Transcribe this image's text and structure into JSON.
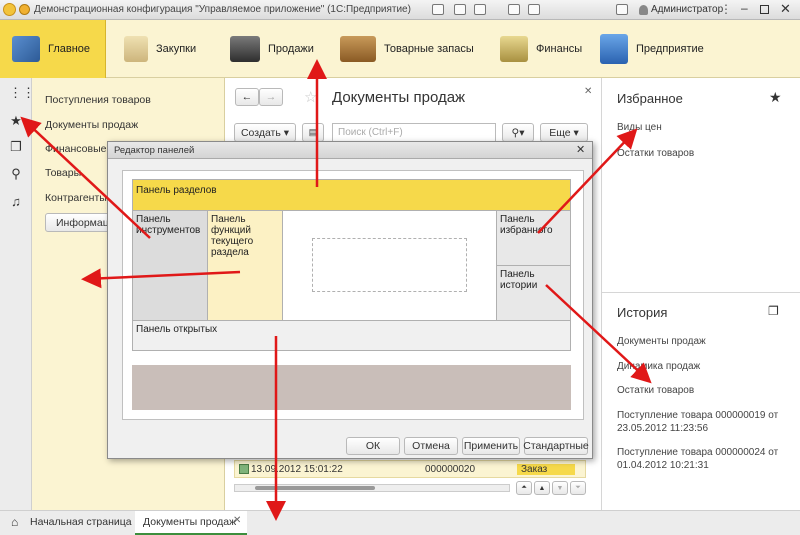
{
  "titlebar": {
    "title": "Демонстрационная конфигурация \"Управляемое приложение\" (1С:Предприятие)",
    "user": "Администратор"
  },
  "sections": [
    {
      "label": "Главное",
      "icon": "desk-lamp-icon"
    },
    {
      "label": "Закупки",
      "icon": "shopping-bag-icon"
    },
    {
      "label": "Продажи",
      "icon": "cash-register-icon"
    },
    {
      "label": "Товарные запасы",
      "icon": "box-icon"
    },
    {
      "label": "Финансы",
      "icon": "coins-icon"
    },
    {
      "label": "Предприятие",
      "icon": "building-icon"
    }
  ],
  "function_panel": {
    "items": [
      "Поступления товаров",
      "Документы продаж",
      "Финансовые д",
      "Товары",
      "Контрагенты"
    ],
    "info_button": "Информаци"
  },
  "workarea": {
    "title": "Документы продаж",
    "create_button": "Создать",
    "search_placeholder": "Поиск (Ctrl+F)",
    "more_button": "Еще",
    "row": {
      "date": "13.09.2012 15:01:22",
      "number": "000000020",
      "type": "Заказ"
    }
  },
  "favorites": {
    "title": "Избранное",
    "items": [
      "Виды цен",
      "Остатки товаров"
    ]
  },
  "history": {
    "title": "История",
    "items": [
      "Документы продаж",
      "Динамика продаж",
      "Остатки товаров",
      "Поступление товара 000000019 от 23.05.2012 11:23:56",
      "Поступление товара 000000024 от 01.04.2012 10:21:31"
    ]
  },
  "bottom_tabs": [
    "Начальная страница",
    "Документы продаж"
  ],
  "dialog": {
    "title": "Редактор панелей",
    "zones": {
      "sections": "Панель разделов",
      "tools": "Панель инструментов",
      "functions": "Панель функций текущего раздела",
      "favorites": "Панель избранного",
      "history": "Панель истории",
      "open": "Панель открытых"
    },
    "buttons": {
      "ok": "ОК",
      "cancel": "Отмена",
      "apply": "Применить",
      "defaults": "Стандартные"
    }
  },
  "colors": {
    "section_active": "#f6d94a",
    "section_bg": "#fbf4d2",
    "arrow": "#e01818"
  }
}
